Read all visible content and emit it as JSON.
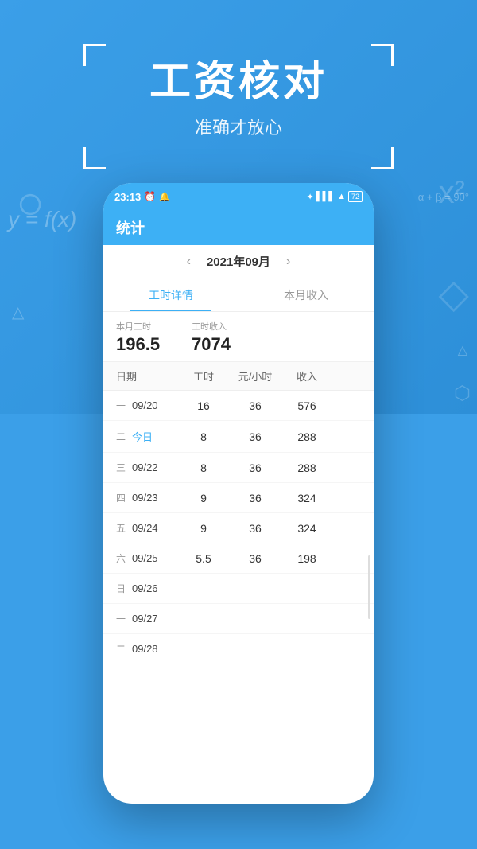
{
  "background": {
    "color": "#3b9fe8"
  },
  "hero": {
    "title": "工资核对",
    "subtitle": "准确才放心"
  },
  "status_bar": {
    "time": "23:13",
    "icons": "✦ ▌▌▌ ▲ 🔋"
  },
  "header": {
    "title": "统计"
  },
  "month_nav": {
    "prev_arrow": "‹",
    "next_arrow": "›",
    "month_text": "2021年09月"
  },
  "tabs": [
    {
      "label": "工时详情",
      "active": true
    },
    {
      "label": "本月收入",
      "active": false
    }
  ],
  "summary": {
    "hours_label": "本月工时",
    "hours_value": "196.5",
    "income_label": "工时收入",
    "income_value": "7074"
  },
  "table": {
    "headers": [
      "日期",
      "工时",
      "元/小时",
      "收入"
    ],
    "rows": [
      {
        "day": "一",
        "date": "09/20",
        "hours": "16",
        "rate": "36",
        "income": "576",
        "today": false
      },
      {
        "day": "二",
        "date": "今日",
        "hours": "8",
        "rate": "36",
        "income": "288",
        "today": true
      },
      {
        "day": "三",
        "date": "09/22",
        "hours": "8",
        "rate": "36",
        "income": "288",
        "today": false
      },
      {
        "day": "四",
        "date": "09/23",
        "hours": "9",
        "rate": "36",
        "income": "324",
        "today": false
      },
      {
        "day": "五",
        "date": "09/24",
        "hours": "9",
        "rate": "36",
        "income": "324",
        "today": false
      },
      {
        "day": "六",
        "date": "09/25",
        "hours": "5.5",
        "rate": "36",
        "income": "198",
        "today": false
      },
      {
        "day": "日",
        "date": "09/26",
        "hours": "",
        "rate": "",
        "income": "",
        "today": false
      },
      {
        "day": "一",
        "date": "09/27",
        "hours": "",
        "rate": "",
        "income": "",
        "today": false
      },
      {
        "day": "二",
        "date": "09/28",
        "hours": "",
        "rate": "",
        "income": "",
        "today": false
      }
    ]
  }
}
